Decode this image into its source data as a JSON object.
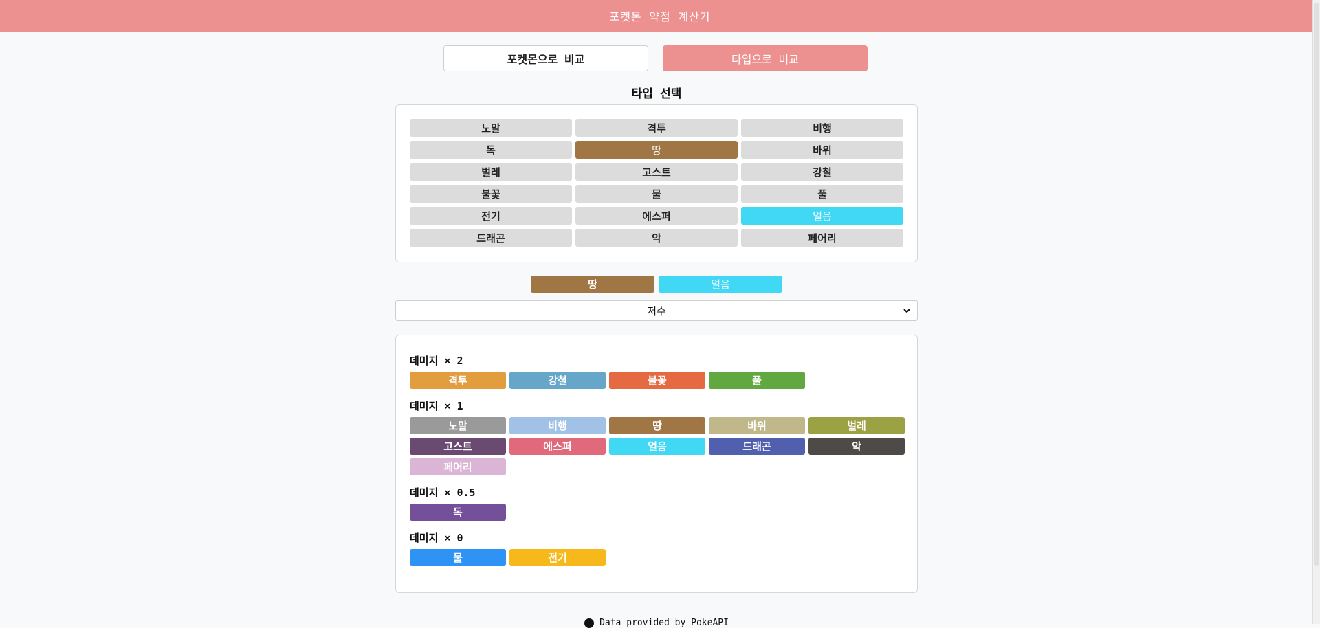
{
  "header": {
    "title": "포켓몬 약점 계산기"
  },
  "mode": {
    "by_pokemon": "포켓몬으로 비교",
    "by_type": "타입으로 비교"
  },
  "type_select_title": "타입 선택",
  "types": [
    {
      "label": "노말",
      "color": "#dcdcdc",
      "selected": false
    },
    {
      "label": "격투",
      "color": "#dcdcdc",
      "selected": false
    },
    {
      "label": "비행",
      "color": "#dcdcdc",
      "selected": false
    },
    {
      "label": "독",
      "color": "#dcdcdc",
      "selected": false
    },
    {
      "label": "땅",
      "color": "#a07644",
      "selected": true
    },
    {
      "label": "바위",
      "color": "#dcdcdc",
      "selected": false
    },
    {
      "label": "벌레",
      "color": "#dcdcdc",
      "selected": false
    },
    {
      "label": "고스트",
      "color": "#dcdcdc",
      "selected": false
    },
    {
      "label": "강철",
      "color": "#dcdcdc",
      "selected": false
    },
    {
      "label": "불꽃",
      "color": "#dcdcdc",
      "selected": false
    },
    {
      "label": "물",
      "color": "#dcdcdc",
      "selected": false
    },
    {
      "label": "풀",
      "color": "#dcdcdc",
      "selected": false
    },
    {
      "label": "전기",
      "color": "#dcdcdc",
      "selected": false
    },
    {
      "label": "에스퍼",
      "color": "#dcdcdc",
      "selected": false
    },
    {
      "label": "얼음",
      "color": "#40d8f5",
      "selected": true
    },
    {
      "label": "드래곤",
      "color": "#dcdcdc",
      "selected": false
    },
    {
      "label": "악",
      "color": "#dcdcdc",
      "selected": false
    },
    {
      "label": "페어리",
      "color": "#dcdcdc",
      "selected": false
    }
  ],
  "chosen": [
    {
      "label": "땅",
      "color": "#a07644"
    },
    {
      "label": "얼음",
      "color": "#40d8f5"
    }
  ],
  "ability": {
    "selected": "저수"
  },
  "results": [
    {
      "title": "데미지 × 2",
      "types": [
        {
          "label": "격투",
          "color": "#e29d3f"
        },
        {
          "label": "강철",
          "color": "#66a6c8"
        },
        {
          "label": "불꽃",
          "color": "#e56a42"
        },
        {
          "label": "풀",
          "color": "#62a841"
        }
      ]
    },
    {
      "title": "데미지 × 1",
      "types": [
        {
          "label": "노말",
          "color": "#9a9a9a"
        },
        {
          "label": "비행",
          "color": "#a2c1e6"
        },
        {
          "label": "땅",
          "color": "#a07644"
        },
        {
          "label": "바위",
          "color": "#c0b88b"
        },
        {
          "label": "벌레",
          "color": "#9ca244"
        },
        {
          "label": "고스트",
          "color": "#6b4a72"
        },
        {
          "label": "에스퍼",
          "color": "#e06a7b"
        },
        {
          "label": "얼음",
          "color": "#40d8f5"
        },
        {
          "label": "드래곤",
          "color": "#5160ae"
        },
        {
          "label": "악",
          "color": "#4e4a48"
        },
        {
          "label": "페어리",
          "color": "#dbb5d6"
        }
      ]
    },
    {
      "title": "데미지 × 0.5",
      "types": [
        {
          "label": "독",
          "color": "#735099"
        }
      ]
    },
    {
      "title": "데미지 × 0",
      "types": [
        {
          "label": "물",
          "color": "#2f93f6"
        },
        {
          "label": "전기",
          "color": "#f7b81b"
        }
      ]
    }
  ],
  "footer": {
    "text": "Data provided by PokeAPI"
  }
}
